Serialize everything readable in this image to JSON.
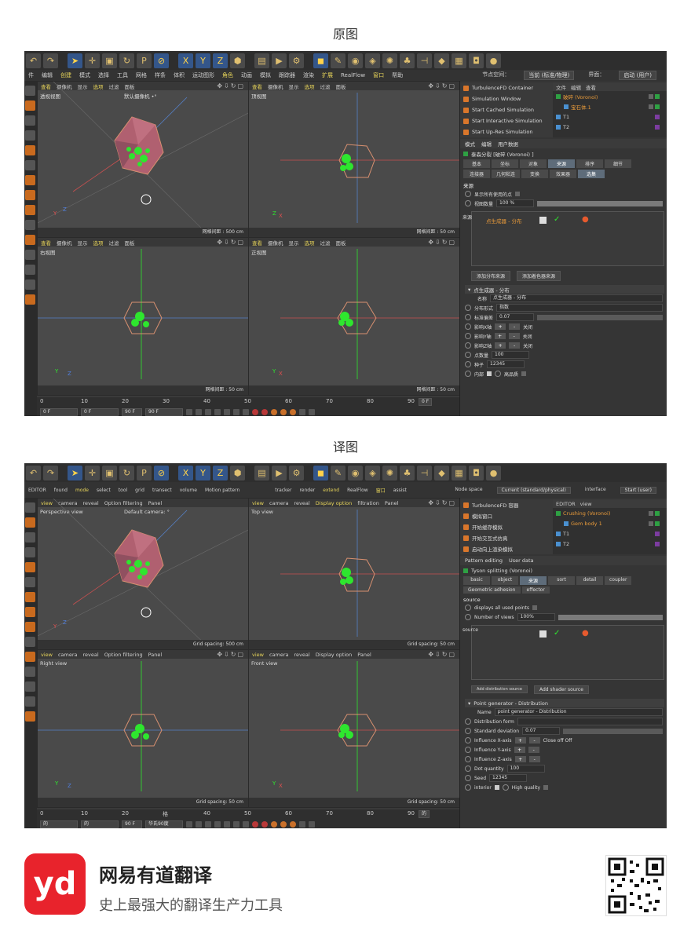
{
  "captions": {
    "original": "原图",
    "translated": "译图"
  },
  "original": {
    "menubar": [
      "件",
      "编辑",
      "创建",
      "模式",
      "选择",
      "工具",
      "网格",
      "样条",
      "体积",
      "运动图形",
      "角色",
      "动画",
      "模拟",
      "跟踪器",
      "渲染",
      "扩展",
      "RealFlow",
      "窗口",
      "帮助"
    ],
    "node_space_label": "节点空间：",
    "node_space_value": "当前 (标准/物理)",
    "interface_label": "界面：",
    "interface_value": "启动 (用户)",
    "vp_menu": [
      "查看",
      "摄像机",
      "显示",
      "选项",
      "过滤",
      "面板"
    ],
    "viewports": [
      {
        "name": "透视视图",
        "camera": "默认摄像机 •°",
        "grid": "网格间距 : 500 cm"
      },
      {
        "name": "顶视图",
        "camera": "",
        "grid": "网格间距 : 50 cm"
      },
      {
        "name": "右视图",
        "camera": "",
        "grid": "网格间距 : 50 cm"
      },
      {
        "name": "正视图",
        "camera": "",
        "grid": "网格间距 : 50 cm"
      }
    ],
    "timeline_ticks": [
      "0",
      "10",
      "20",
      "30",
      "40",
      "50",
      "60",
      "70",
      "80",
      "90"
    ],
    "timeline_fields": [
      "0 F",
      "0 F",
      "90 F",
      "90 F"
    ],
    "frame_field": "0 F",
    "rp_menu": [
      "TurbulenceFD Container",
      "Simulation Window",
      "Start Cached Simulation",
      "Start Interactive Simulation",
      "Start Up-Res Simulation"
    ],
    "obj_header": [
      "文件",
      "编辑",
      "查看"
    ],
    "obj_rows": [
      "破碎 (Voronoi)",
      "宝石体.1",
      "T1",
      "T2"
    ],
    "attr_header": [
      "模式",
      "编辑",
      "用户数据"
    ],
    "attr_title": "泰森分裂 [破碎 (Voronoi) ]",
    "tabs": [
      "基本",
      "坐标",
      "对象",
      "来源",
      "排序",
      "细节",
      "连接器",
      "几何粘连",
      "变换",
      "效果器",
      "选集"
    ],
    "source_section": "来源",
    "show_points": "显示所有使用的点",
    "viewport_amount_label": "视图数量",
    "viewport_amount_value": "100 %",
    "source_label": "来源",
    "source_item": "点生成器 - 分布",
    "add_dist": "添加分布来源",
    "add_shader": "添加着色器来源",
    "sub_title": "点生成器 - 分布",
    "name_label": "名称",
    "name_value": "点生成器 - 分布",
    "dist_type_label": "分布形式",
    "dist_type_value": "指数",
    "std_dev_label": "标准偏差",
    "std_dev_value": "0.07",
    "influence": [
      "影响X轴",
      "影响Y轴",
      "影响Z轴"
    ],
    "off": "关闭",
    "count_label": "点数量",
    "count_value": "100",
    "seed_label": "种子",
    "seed_value": "12345",
    "inner_label": "内部",
    "hq_label": "高品质"
  },
  "translated": {
    "menubar": [
      "EDITOR",
      "found",
      "mode",
      "select",
      "tool",
      "grid",
      "transect",
      "volume",
      "Motion pattern"
    ],
    "vp_menu1": [
      "tracker",
      "render",
      "extend",
      "RealFlow",
      "窗口",
      "assist"
    ],
    "node_space_label": "Node space",
    "node_space_value": "Current (standard/physical)",
    "interface_label": "interface",
    "interface_value": "Start (user)",
    "vp_menu": [
      "view",
      "camera",
      "reveal",
      "Option filtering",
      "Panel"
    ],
    "vp_menu_b": [
      "view",
      "camera",
      "reveal",
      "Display option",
      "filtration",
      "Panel"
    ],
    "viewports": [
      {
        "name": "Perspective view",
        "camera": "Default camera: °",
        "grid": "Grid spacing: 500 cm"
      },
      {
        "name": "Top view",
        "camera": "",
        "grid": "Grid spacing: 50 cm"
      },
      {
        "name": "Right view",
        "camera": "",
        "grid": "Grid spacing: 50 cm"
      },
      {
        "name": "Front view",
        "camera": "",
        "grid": "Grid spacing: 50 cm"
      }
    ],
    "timeline_ticks": [
      "0",
      "10",
      "20",
      "格",
      "40",
      "50",
      "60",
      "70",
      "80",
      "90"
    ],
    "timeline_fields": [
      "的",
      "的",
      "90 F",
      "华氏90度"
    ],
    "frame_field": "的",
    "rp_menu": [
      "TurbulenceFD 容器",
      "模拟窗口",
      "开始缓存模拟",
      "开始交互式仿真",
      "启动向上渲染模拟"
    ],
    "obj_header": [
      "EDITOR",
      "view"
    ],
    "obj_rows": [
      "Crushing (Voronoi)",
      "Gem body 1",
      "T1",
      "T2"
    ],
    "attr_header": [
      "Pattern editing",
      "User data"
    ],
    "attr_title": "Tyson splitting (Voronoi)",
    "tabs": [
      "basic",
      "object",
      "来源",
      "sort",
      "detail",
      "coupler",
      "Geometric adhesion",
      "effector"
    ],
    "source_section": "source",
    "show_points": "displays all used points",
    "viewport_amount_label": "Number of views",
    "viewport_amount_value": "100%",
    "source_label": "source",
    "source_item": "",
    "add_dist": "Add distribution source",
    "add_shader": "Add shader source",
    "sub_title": "Point generator - Distribution",
    "name_label": "Name",
    "name_value": "point generator - Distribution",
    "dist_type_label": "Distribution form",
    "dist_type_value": "",
    "std_dev_label": "Standard deviation",
    "std_dev_value": "0.07",
    "influence": [
      "Influence X-axis",
      "Influence Y-axis",
      "Influence Z-axis"
    ],
    "off": "Close off Off",
    "count_label": "Dot quantity",
    "count_value": "100",
    "seed_label": "Seed",
    "seed_value": "12345",
    "inner_label": "interior",
    "hq_label": "High quality"
  },
  "brand": {
    "logo_text": "yd",
    "name": "网易有道翻译",
    "slogan": "史上最强大的翻译生产力工具"
  },
  "colors": {
    "accent": "#e8232c",
    "highlight": "#e7d45a",
    "orange": "#d9762b",
    "green": "#2ee62e"
  }
}
